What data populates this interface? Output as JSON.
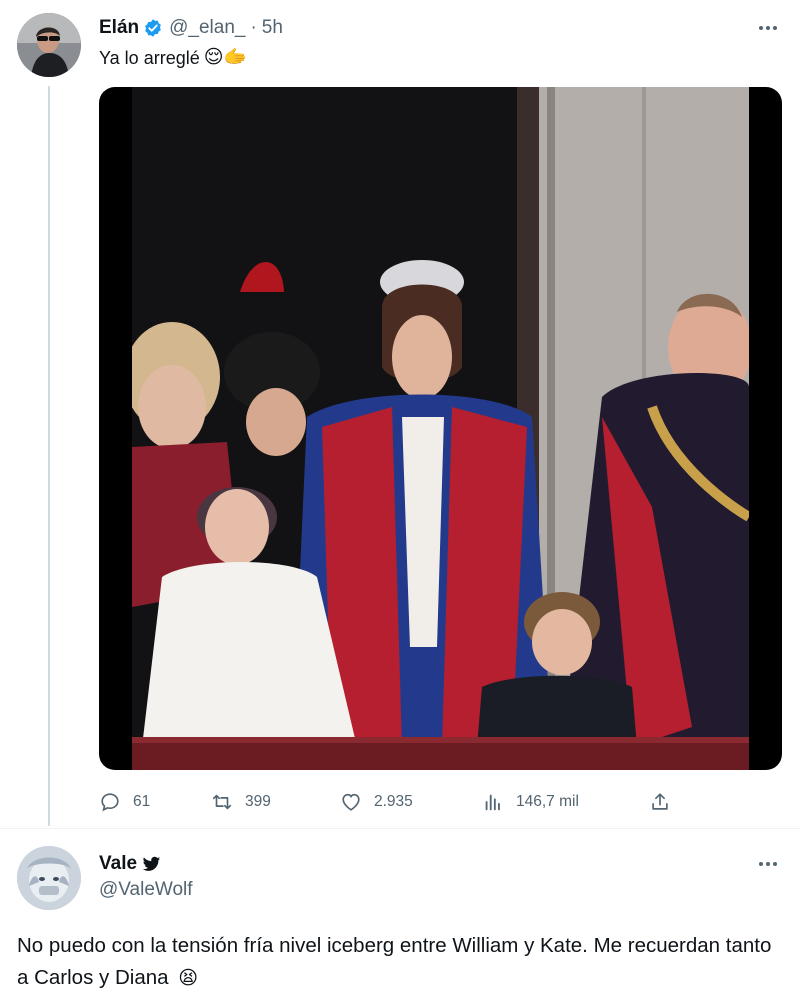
{
  "tweet": {
    "author_name": "Elán",
    "handle": "@_elan_",
    "separator": "·",
    "time": "5h",
    "text": "Ya lo arreglé",
    "emojis": "😌🫱",
    "verified": true,
    "more_icon": "more-horizontal-icon",
    "media_icon": "photo",
    "actions": {
      "replies": "61",
      "retweets": "399",
      "likes": "2.935",
      "views": "146,7 mil"
    }
  },
  "reply": {
    "author_name": "Vale",
    "handle": "@ValeWolf",
    "text": "No puedo con la tensión fría nivel iceberg entre William y Kate. Me recuerdan tanto a Carlos y Diana",
    "emoji": "😫",
    "badge_icon": "bird-icon"
  },
  "colors": {
    "text": "#0f1419",
    "secondary": "#536471",
    "verified": "#1d9bf0",
    "divider": "#eff3f4",
    "thread_line": "#cfd9de"
  }
}
